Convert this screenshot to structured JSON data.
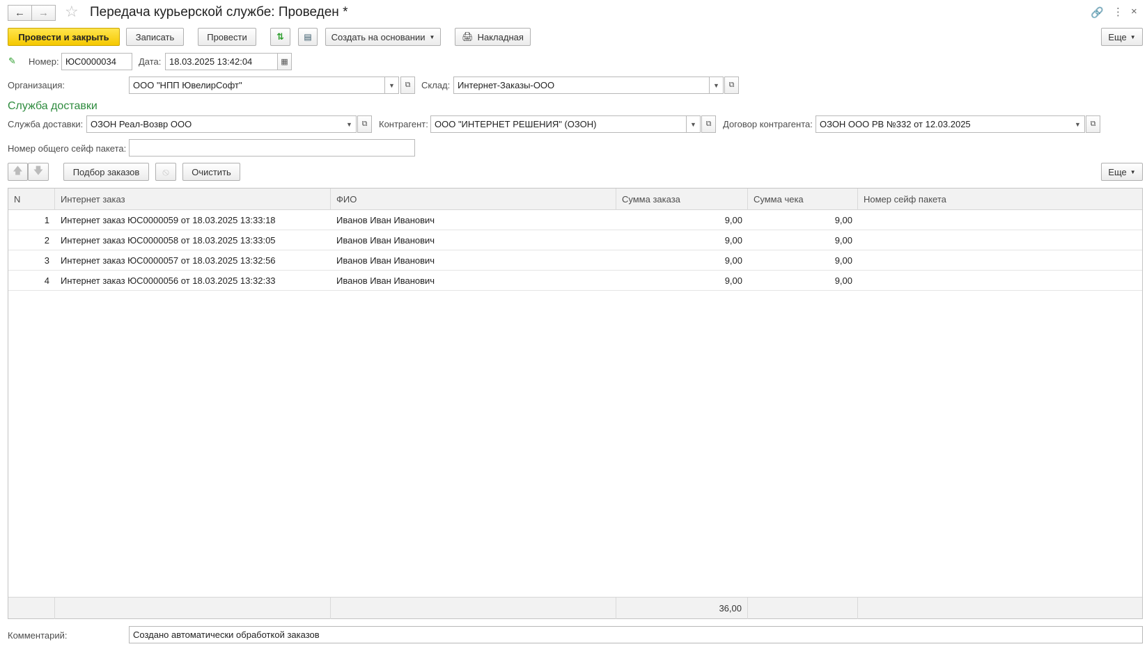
{
  "window": {
    "title": "Передача курьерской службе: Проведен *"
  },
  "toolbar": {
    "post_close": "Провести и закрыть",
    "save": "Записать",
    "post": "Провести",
    "create_based": "Создать на основании",
    "invoice": "Накладная",
    "more": "Еще"
  },
  "header": {
    "number_label": "Номер:",
    "number_value": "ЮС0000034",
    "date_label": "Дата:",
    "date_value": "18.03.2025 13:42:04",
    "org_label": "Организация:",
    "org_value": "ООО \"НПП ЮвелирСофт\"",
    "warehouse_label": "Склад:",
    "warehouse_value": "Интернет-Заказы-ООО"
  },
  "delivery": {
    "section_title": "Служба доставки",
    "service_label": "Служба доставки:",
    "service_value": "ОЗОН Реал-Возвр ООО",
    "counterparty_label": "Контрагент:",
    "counterparty_value": "ООО \"ИНТЕРНЕТ РЕШЕНИЯ\" (ОЗОН)",
    "contract_label": "Договор контрагента:",
    "contract_value": "ОЗОН ООО РВ №332 от 12.03.2025",
    "safe_label": "Номер общего сейф пакета:",
    "safe_value": ""
  },
  "table_toolbar": {
    "pick_orders": "Подбор заказов",
    "clear": "Очистить",
    "more": "Еще"
  },
  "table": {
    "columns": [
      "N",
      "Интернет заказ",
      "ФИО",
      "Сумма заказа",
      "Сумма чека",
      "Номер сейф пакета"
    ],
    "rows": [
      {
        "n": "1",
        "order": "Интернет заказ ЮС0000059 от 18.03.2025 13:33:18",
        "fio": "Иванов Иван Иванович",
        "sum": "9,00",
        "check": "9,00",
        "safe": ""
      },
      {
        "n": "2",
        "order": "Интернет заказ ЮС0000058 от 18.03.2025 13:33:05",
        "fio": "Иванов Иван Иванович",
        "sum": "9,00",
        "check": "9,00",
        "safe": ""
      },
      {
        "n": "3",
        "order": "Интернет заказ ЮС0000057 от 18.03.2025 13:32:56",
        "fio": "Иванов Иван Иванович",
        "sum": "9,00",
        "check": "9,00",
        "safe": ""
      },
      {
        "n": "4",
        "order": "Интернет заказ ЮС0000056 от 18.03.2025 13:32:33",
        "fio": "Иванов Иван Иванович",
        "sum": "9,00",
        "check": "9,00",
        "safe": ""
      }
    ],
    "total_sum": "36,00"
  },
  "footer": {
    "comment_label": "Комментарий:",
    "comment_value": "Создано автоматически обработкой заказов"
  },
  "colors": {
    "primary_button": "#f5c800",
    "section_title": "#2e8b3e"
  }
}
